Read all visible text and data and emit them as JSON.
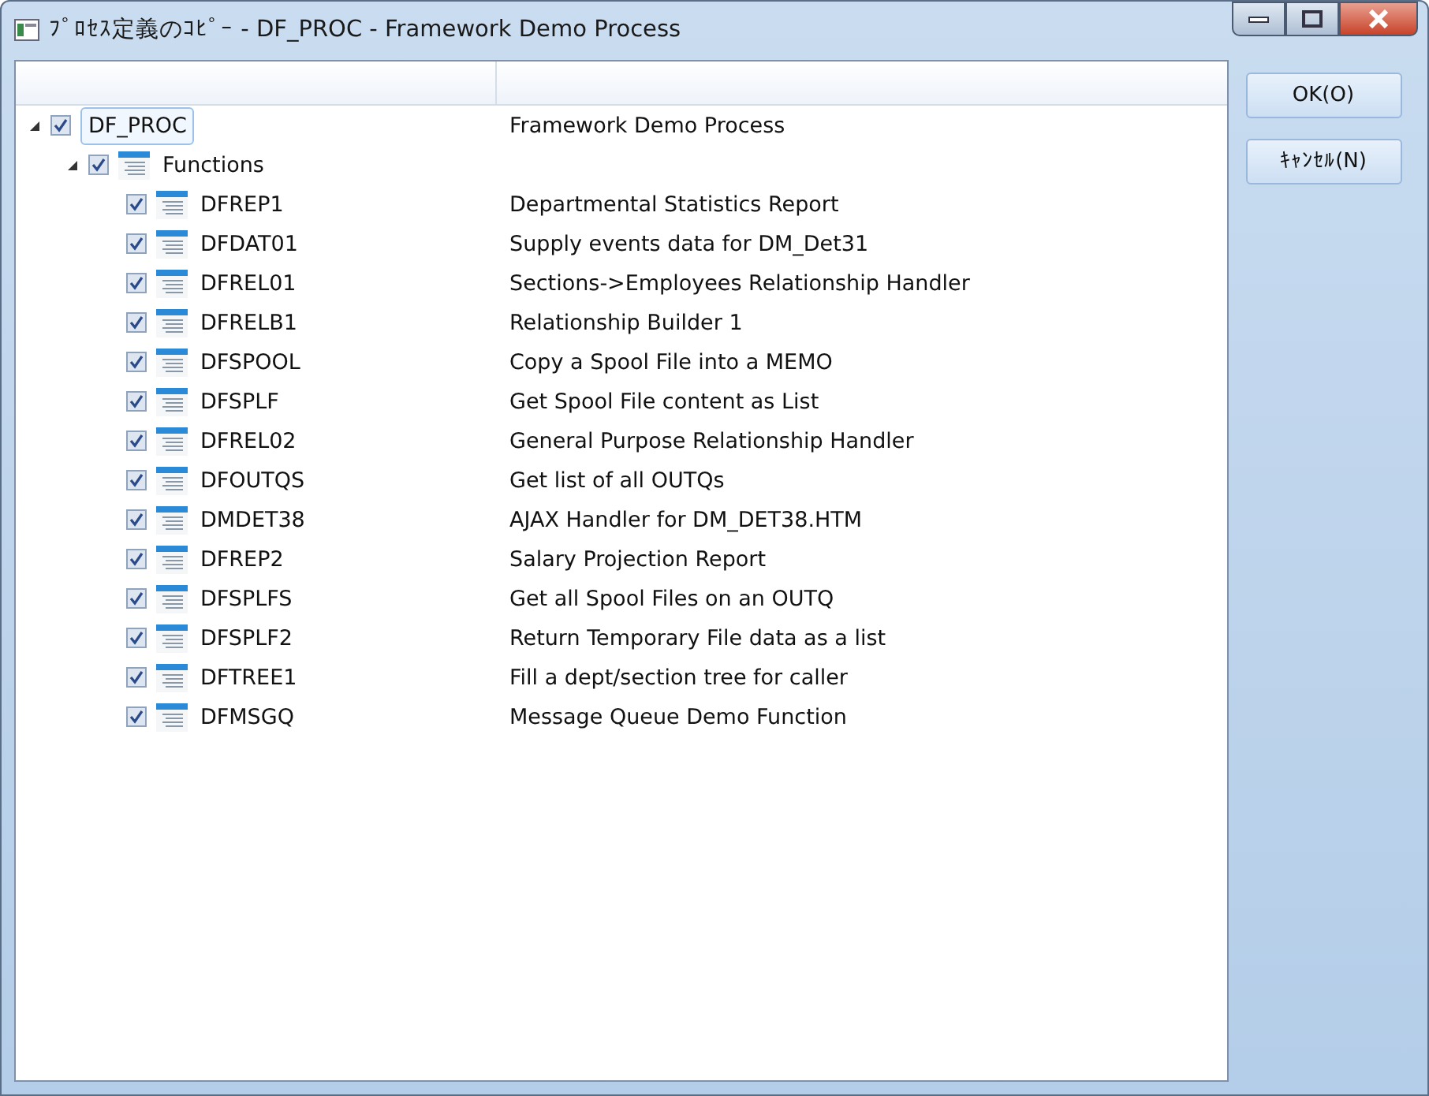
{
  "window": {
    "title": "ﾌﾟﾛｾｽ定義のｺﾋﾟｰ - DF_PROC - Framework Demo Process"
  },
  "tree": [
    {
      "name": "DF_PROC",
      "description": "Framework Demo Process",
      "checked": true,
      "expanded": true,
      "selected": true,
      "children": [
        {
          "name": "Functions",
          "checked": true,
          "expanded": true,
          "selected": false,
          "kind": "folder",
          "children": [
            {
              "name": "DFREP1",
              "description": "Departmental Statistics Report",
              "checked": true,
              "selected": false,
              "kind": "function"
            },
            {
              "name": "DFDAT01",
              "description": "Supply events data for DM_Det31",
              "checked": true,
              "selected": false,
              "kind": "function"
            },
            {
              "name": "DFREL01",
              "description": "Sections->Employees Relationship Handler",
              "checked": true,
              "selected": false,
              "kind": "function"
            },
            {
              "name": "DFRELB1",
              "description": "Relationship Builder 1",
              "checked": true,
              "selected": false,
              "kind": "function"
            },
            {
              "name": "DFSPOOL",
              "description": "Copy a Spool File into a MEMO",
              "checked": true,
              "selected": false,
              "kind": "function"
            },
            {
              "name": "DFSPLF",
              "description": "Get Spool File content as List",
              "checked": true,
              "selected": false,
              "kind": "function"
            },
            {
              "name": "DFREL02",
              "description": "General Purpose Relationship Handler",
              "checked": true,
              "selected": false,
              "kind": "function"
            },
            {
              "name": "DFOUTQS",
              "description": "Get list of all OUTQs",
              "checked": true,
              "selected": false,
              "kind": "function"
            },
            {
              "name": "DMDET38",
              "description": "AJAX Handler for DM_DET38.HTM",
              "checked": true,
              "selected": false,
              "kind": "function"
            },
            {
              "name": "DFREP2",
              "description": "Salary Projection Report",
              "checked": true,
              "selected": false,
              "kind": "function"
            },
            {
              "name": "DFSPLFS",
              "description": "Get all Spool Files on an OUTQ",
              "checked": true,
              "selected": false,
              "kind": "function"
            },
            {
              "name": "DFSPLF2",
              "description": "Return Temporary File data as a list",
              "checked": true,
              "selected": false,
              "kind": "function"
            },
            {
              "name": "DFTREE1",
              "description": "Fill a dept/section tree for caller",
              "checked": true,
              "selected": false,
              "kind": "function"
            },
            {
              "name": "DFMSGQ",
              "description": "Message Queue Demo Function",
              "checked": true,
              "selected": false,
              "kind": "function"
            }
          ]
        }
      ]
    }
  ],
  "buttons": [
    {
      "label": "OK(O)"
    },
    {
      "label": "ｷｬﾝｾﾙ(N)"
    }
  ]
}
